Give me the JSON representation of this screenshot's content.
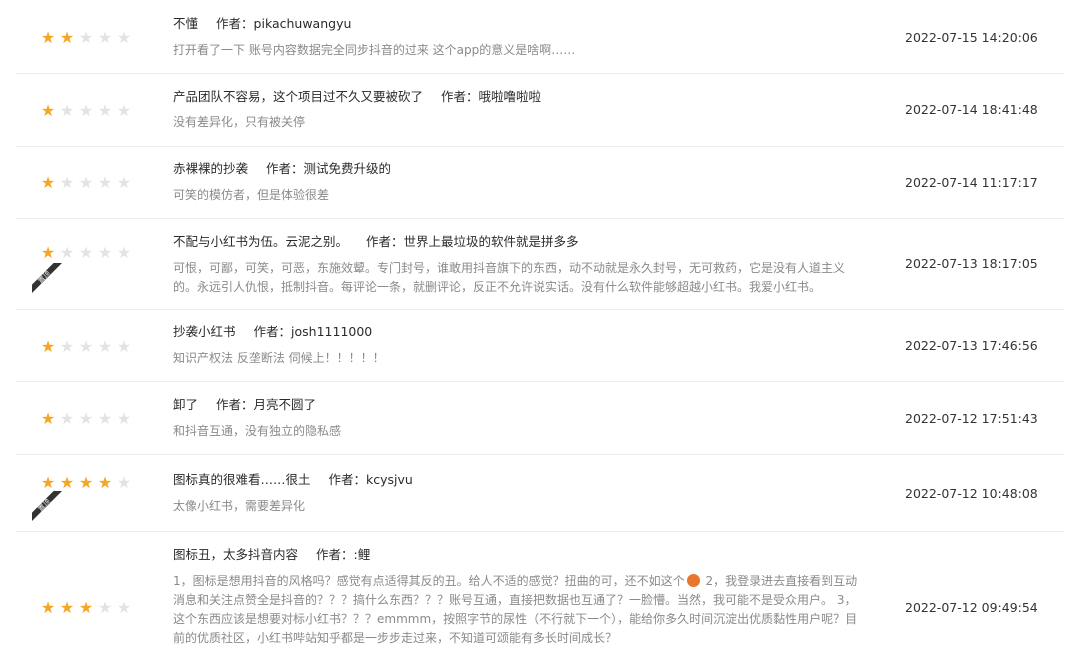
{
  "author_label": "作者：",
  "pin_label": "置顶",
  "colors": {
    "star_on": "#f5a623",
    "star_off": "#e3e3e3",
    "pin": "#333333"
  },
  "reviews": [
    {
      "rating": 2,
      "title": "不懂",
      "author": "pikachuwangyu",
      "content": "打开看了一下 账号内容数据完全同步抖音的过来 这个app的意义是啥啊……",
      "time": "2022-07-15 14:20:06",
      "pinned": false
    },
    {
      "rating": 1,
      "title": "产品团队不容易，这个项目过不久又要被砍了",
      "author": "哦啦噜啦啦",
      "content": "没有差异化，只有被关停",
      "time": "2022-07-14 18:41:48",
      "pinned": false
    },
    {
      "rating": 1,
      "title": "赤裸裸的抄袭",
      "author": "测试免费升级的",
      "content": "可笑的模仿者，但是体验很差",
      "time": "2022-07-14 11:17:17",
      "pinned": false
    },
    {
      "rating": 1,
      "title": "不配与小红书为伍。云泥之别。",
      "author": "世界上最垃圾的软件就是拼多多",
      "content": "可恨，可鄙，可笑，可恶，东施效颦。专门封号，谁敢用抖音旗下的东西，动不动就是永久封号，无可救药，它是没有人道主义的。永远引人仇恨，抵制抖音。每评论一条，就删评论，反正不允许说实话。没有什么软件能够超越小红书。我爱小红书。",
      "time": "2022-07-13 18:17:05",
      "pinned": true
    },
    {
      "rating": 1,
      "title": "抄袭小红书",
      "author": "josh1111000",
      "content": "知识产权法 反垄断法 伺候上！！！！！",
      "time": "2022-07-13 17:46:56",
      "pinned": false
    },
    {
      "rating": 1,
      "title": "卸了",
      "author": "月亮不圆了",
      "content": "和抖音互通，没有独立的隐私感",
      "time": "2022-07-12 17:51:43",
      "pinned": false
    },
    {
      "rating": 4,
      "title": "图标真的很难看……很土",
      "author": "kcysjvu",
      "content": "太像小红书，需要差异化",
      "time": "2022-07-12 10:48:08",
      "pinned": true
    },
    {
      "rating": 3,
      "title": "图标丑，太多抖音内容",
      "author": ":鲤",
      "content_pre": "1，图标是想用抖音的风格吗？感觉有点适得其反的丑。给人不适的感觉？扭曲的可，还不如这个",
      "content_post": " 2，我登录进去直接看到互动消息和关注点赞全是抖音的？？？搞什么东西？？？账号互通，直接把数据也互通了？一脸懵。当然，我可能不是受众用户。 3，这个东西应该是想要对标小红书？？？emmmm，按照字节的尿性（不行就下一个），能给你多久时间沉淀出优质黏性用户呢？目前的优质社区，小红书哔站知乎都是一步步走过来，不知道可颂能有多长时间成长？",
      "time": "2022-07-12 09:49:54",
      "pinned": false
    }
  ]
}
